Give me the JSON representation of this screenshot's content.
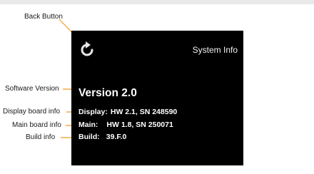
{
  "screen": {
    "title": "System Info",
    "version": "Version 2.0",
    "info": [
      {
        "label": "Display:",
        "value": "HW 2.1, SN 248590"
      },
      {
        "label": "Main:",
        "value": "HW 1.8, SN 250071"
      },
      {
        "label": "Build:",
        "value": "39.F.0"
      }
    ]
  },
  "callouts": {
    "back_button": "Back Button",
    "software_version": "Software Version",
    "display_board": "Display board info",
    "main_board": "Main board info",
    "build": "Build info"
  },
  "icons": {
    "back": "refresh-arrow-icon"
  },
  "colors": {
    "screen_bg": "#000000",
    "text": "#ffffff",
    "leader": "#f39a1e"
  }
}
